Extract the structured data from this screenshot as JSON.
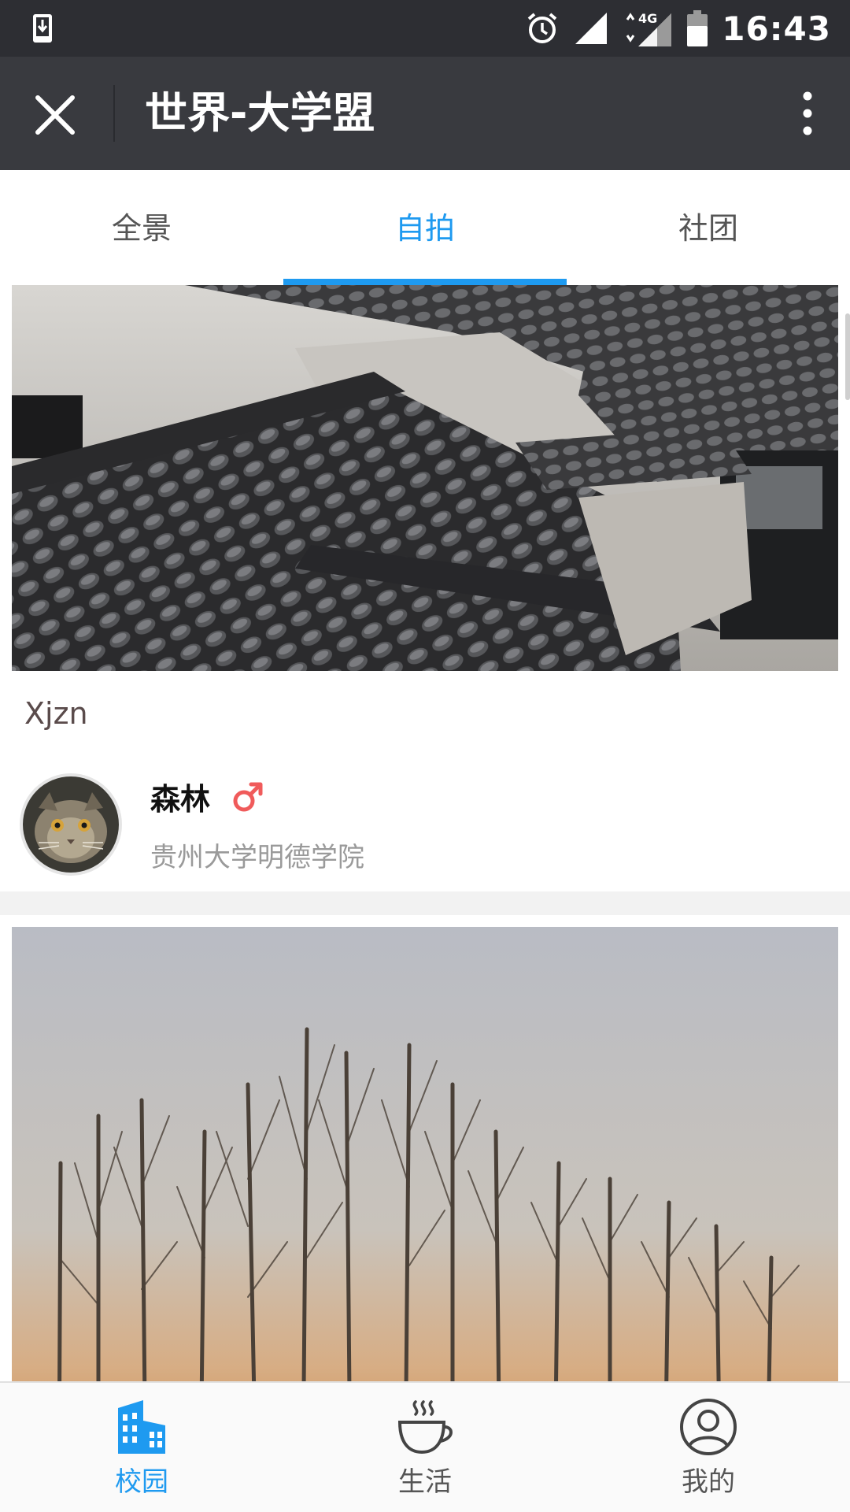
{
  "status_bar": {
    "time": "16:43",
    "network": "4G"
  },
  "app_bar": {
    "title": "世界-大学盟"
  },
  "tabs": [
    {
      "label": "全景",
      "active": false
    },
    {
      "label": "自拍",
      "active": true
    },
    {
      "label": "社团",
      "active": false
    }
  ],
  "posts": [
    {
      "caption": "Xjzn",
      "author": {
        "name": "森林",
        "gender": "male",
        "school": "贵州大学明德学院"
      }
    }
  ],
  "bottom_nav": [
    {
      "label": "校园",
      "icon": "building-icon",
      "active": true
    },
    {
      "label": "生活",
      "icon": "coffee-cup-icon",
      "active": false
    },
    {
      "label": "我的",
      "icon": "user-icon",
      "active": false
    }
  ],
  "colors": {
    "accent": "#1e9af0",
    "appbar": "#393a3f",
    "statusbar": "#2d2e33",
    "male": "#f05b5b"
  }
}
